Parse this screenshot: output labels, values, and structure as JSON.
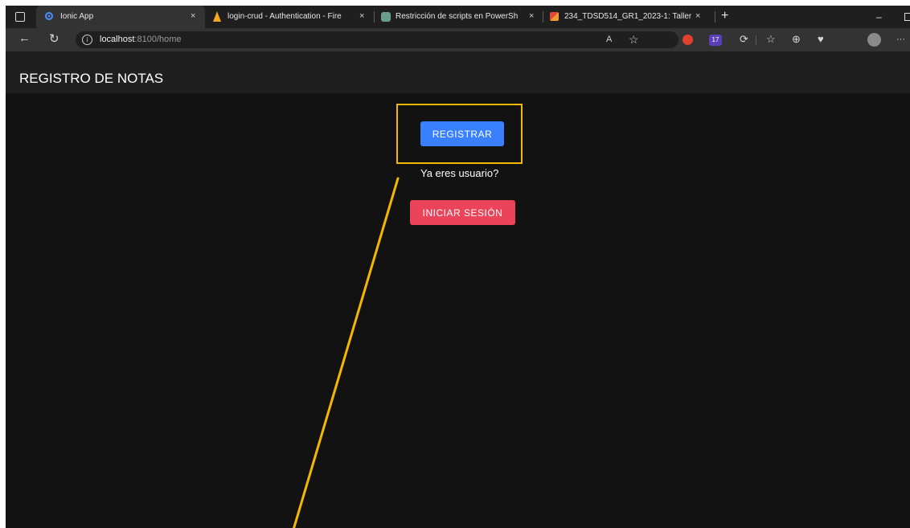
{
  "browser": {
    "tabs": [
      {
        "title": "Ionic App",
        "close": "×",
        "icon": "ionic-icon"
      },
      {
        "title": "login-crud - Authentication - Fire",
        "close": "×",
        "icon": "firebase-icon"
      },
      {
        "title": "Restricción de scripts en PowerSh",
        "close": "×",
        "icon": "chatgpt-icon"
      },
      {
        "title": "234_TDSD514_GR1_2023-1: Taller",
        "close": "×",
        "icon": "moodle-icon"
      }
    ],
    "new_tab": "+",
    "minimize": "–",
    "address": {
      "host": "localhost",
      "path": ":8100/home"
    },
    "read_aloud": "A",
    "extension_badge": "17",
    "more": "···"
  },
  "app": {
    "title": "REGISTRO DE NOTAS",
    "register_label": "REGISTRAR",
    "hint": "Ya eres usuario?",
    "login_label": "INICIAR SESIÓN"
  },
  "colors": {
    "register_button": "#3880ff",
    "login_button": "#eb445a",
    "annotation": "#f3b900",
    "background": "#121212"
  }
}
